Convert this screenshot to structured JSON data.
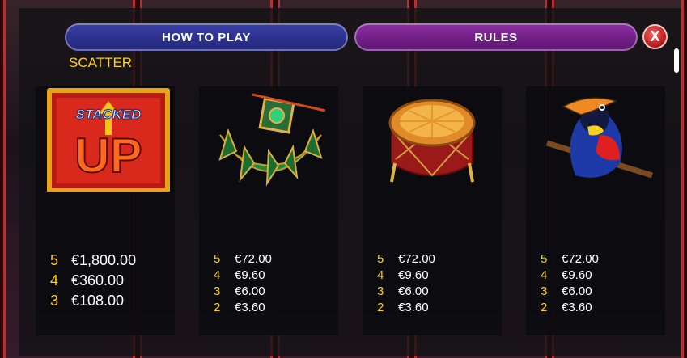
{
  "tabs": {
    "how_to_play": "HOW TO PLAY",
    "rules": "RULES"
  },
  "close_label": "X",
  "section_title": "SCATTER",
  "colors": {
    "accent_yellow": "#ffd200",
    "tab_blue": "#2b319a",
    "tab_purple": "#74208a",
    "close_red": "#d02020"
  },
  "cards": [
    {
      "symbol": "stacked-up-scatter",
      "logo_text_top": "STACKED",
      "logo_text_big": "UP",
      "pays": [
        {
          "count": "5",
          "amount": "€1,800.00"
        },
        {
          "count": "4",
          "amount": "€360.00"
        },
        {
          "count": "3",
          "amount": "€108.00"
        }
      ]
    },
    {
      "symbol": "fan-mask",
      "pays": [
        {
          "count": "5",
          "amount": "€72.00"
        },
        {
          "count": "4",
          "amount": "€9.60"
        },
        {
          "count": "3",
          "amount": "€6.00"
        },
        {
          "count": "2",
          "amount": "€3.60"
        }
      ]
    },
    {
      "symbol": "drum",
      "pays": [
        {
          "count": "5",
          "amount": "€72.00"
        },
        {
          "count": "4",
          "amount": "€9.60"
        },
        {
          "count": "3",
          "amount": "€6.00"
        },
        {
          "count": "2",
          "amount": "€3.60"
        }
      ]
    },
    {
      "symbol": "toucan",
      "pays": [
        {
          "count": "5",
          "amount": "€72.00"
        },
        {
          "count": "4",
          "amount": "€9.60"
        },
        {
          "count": "3",
          "amount": "€6.00"
        },
        {
          "count": "2",
          "amount": "€3.60"
        }
      ]
    }
  ]
}
